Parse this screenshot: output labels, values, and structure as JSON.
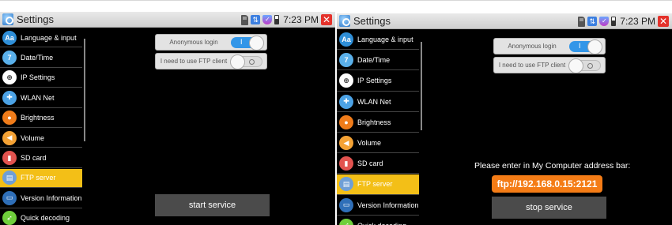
{
  "colors": {
    "active_item": "#f3bf17",
    "toggle_on": "#3296e8",
    "url_badge": "#f47c16",
    "close": "#e4322b"
  },
  "statusbar": {
    "title": "Settings",
    "time": "7:23 PM",
    "icons": [
      "sd-card-icon",
      "usb-icon",
      "shield-icon",
      "battery-icon",
      "close-icon"
    ]
  },
  "sidebar": {
    "items": [
      {
        "label": "Language & input",
        "icon": "language-icon",
        "glyph": "Aa",
        "color": "#2f8fd8"
      },
      {
        "label": "Date/Time",
        "icon": "calendar-icon",
        "glyph": "7",
        "color": "#5ab0ea"
      },
      {
        "label": "IP Settings",
        "icon": "network-icon",
        "glyph": "⊕",
        "color": "#ffffff"
      },
      {
        "label": "WLAN Net",
        "icon": "wifi-icon",
        "glyph": "✚",
        "color": "#4ca3e6"
      },
      {
        "label": "Brightness",
        "icon": "brightness-icon",
        "glyph": "●",
        "color": "#f07c1a"
      },
      {
        "label": "Volume",
        "icon": "volume-icon",
        "glyph": "◀",
        "color": "#f4a235"
      },
      {
        "label": "SD card",
        "icon": "sd-icon",
        "glyph": "▮",
        "color": "#e2534f"
      },
      {
        "label": "FTP server",
        "icon": "ftp-icon",
        "glyph": "▤",
        "color": "#6f9fd6"
      },
      {
        "label": "Version Information",
        "icon": "info-icon",
        "glyph": "▭",
        "color": "#2f6fb8"
      },
      {
        "label": "Quick decoding",
        "icon": "rocket-icon",
        "glyph": "➶",
        "color": "#6fcf3b"
      }
    ]
  },
  "left": {
    "anonymous_label": "Anonymous login",
    "anonymous_on": true,
    "ftp_client_label": "I need to use FTP client",
    "ftp_client_on": false,
    "service_button": "start service"
  },
  "right": {
    "anonymous_label": "Anonymous login",
    "anonymous_on": true,
    "ftp_client_label": "I need to use FTP client",
    "ftp_client_on": false,
    "hint": "Please enter in  My Computer address bar:",
    "ftp_url": "ftp://192.168.0.15:2121",
    "service_button": "stop service"
  }
}
